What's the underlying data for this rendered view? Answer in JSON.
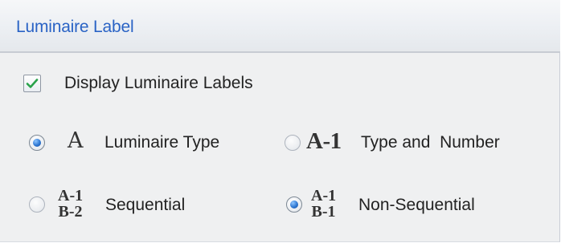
{
  "panel": {
    "title": "Luminaire Label"
  },
  "display_labels": {
    "label": "Display Luminaire Labels",
    "checked": true,
    "check_color": "#29a24a"
  },
  "options": {
    "luminaire_type": {
      "glyph": "A",
      "label": "Luminaire Type",
      "selected": true
    },
    "type_and_number": {
      "glyph": "A-1",
      "label": "Type and  Number",
      "selected": false
    },
    "sequential": {
      "glyph_top": "A-1",
      "glyph_bottom": "B-2",
      "label": "Sequential",
      "selected": false
    },
    "non_sequential": {
      "glyph_top": "A-1",
      "glyph_bottom": "B-1",
      "label": "Non-Sequential",
      "selected": true
    }
  },
  "colors": {
    "title": "#2a63c5",
    "panel_bg": "#eff0f1",
    "radio_selected": "#2f78d3"
  }
}
